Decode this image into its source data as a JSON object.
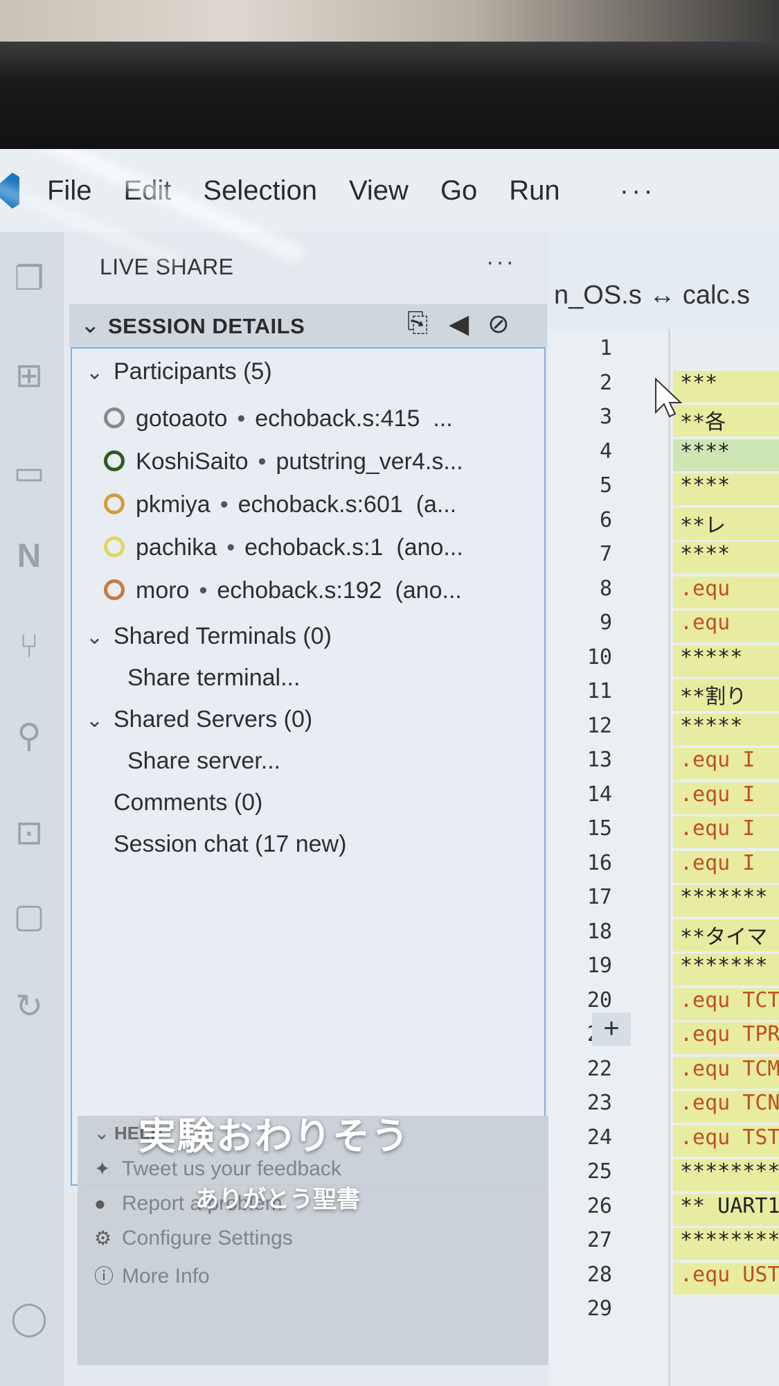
{
  "menubar": {
    "items": [
      "File",
      "Edit",
      "Selection",
      "View",
      "Go",
      "Run"
    ],
    "more": "···"
  },
  "sidebar": {
    "header": "LIVE SHARE",
    "more": "···",
    "session": {
      "title": "SESSION DETAILS",
      "participants_label": "Participants (5)",
      "participants": [
        {
          "name": "gotoaoto",
          "location": "echoback.s:415",
          "extra": "...",
          "color": "#8a8a8a"
        },
        {
          "name": "KoshiSaito",
          "location": "putstring_ver4.s...",
          "extra": "",
          "color": "#2f5a1e"
        },
        {
          "name": "pkmiya",
          "location": "echoback.s:601",
          "extra": "(a...",
          "color": "#d99a3a"
        },
        {
          "name": "pachika",
          "location": "echoback.s:1",
          "extra": "(ano...",
          "color": "#e4d45a"
        },
        {
          "name": "moro",
          "location": "echoback.s:192",
          "extra": "(ano...",
          "color": "#c87a3e"
        }
      ],
      "terminals_label": "Shared Terminals (0)",
      "share_terminal": "Share terminal...",
      "servers_label": "Shared Servers (0)",
      "share_server": "Share server...",
      "comments": "Comments (0)",
      "chat": "Session chat (17 new)"
    },
    "help": {
      "title": "HELP",
      "items": [
        "Tweet us your feedback",
        "Report a problem",
        "Configure Settings",
        "More Info"
      ]
    }
  },
  "caption": {
    "main": "実験おわりそう",
    "sub": "ありがとう聖書"
  },
  "editor": {
    "tab_title": "n_OS.s ↔ calc.s",
    "line_numbers": [
      "1",
      "2",
      "3",
      "4",
      "5",
      "6",
      "7",
      "8",
      "9",
      "10",
      "11",
      "12",
      "13",
      "14",
      "15",
      "16",
      "17",
      "18",
      "19",
      "20",
      "21",
      "22",
      "23",
      "24",
      "25",
      "26",
      "27",
      "28",
      "29"
    ],
    "code_lines": [
      "",
      "***",
      "**各",
      "****",
      "****",
      "**レ",
      "****",
      ".equ",
      ".equ",
      "*****",
      "**割り",
      "*****",
      ".equ I",
      ".equ I",
      ".equ I",
      ".equ I",
      "*******",
      "**タイマ",
      "*******",
      ".equ TCT",
      ".equ TPR",
      ".equ TCM",
      ".equ TCN",
      ".equ TST",
      "*********",
      "** UART1",
      "*********",
      ".equ USTC",
      ""
    ]
  }
}
